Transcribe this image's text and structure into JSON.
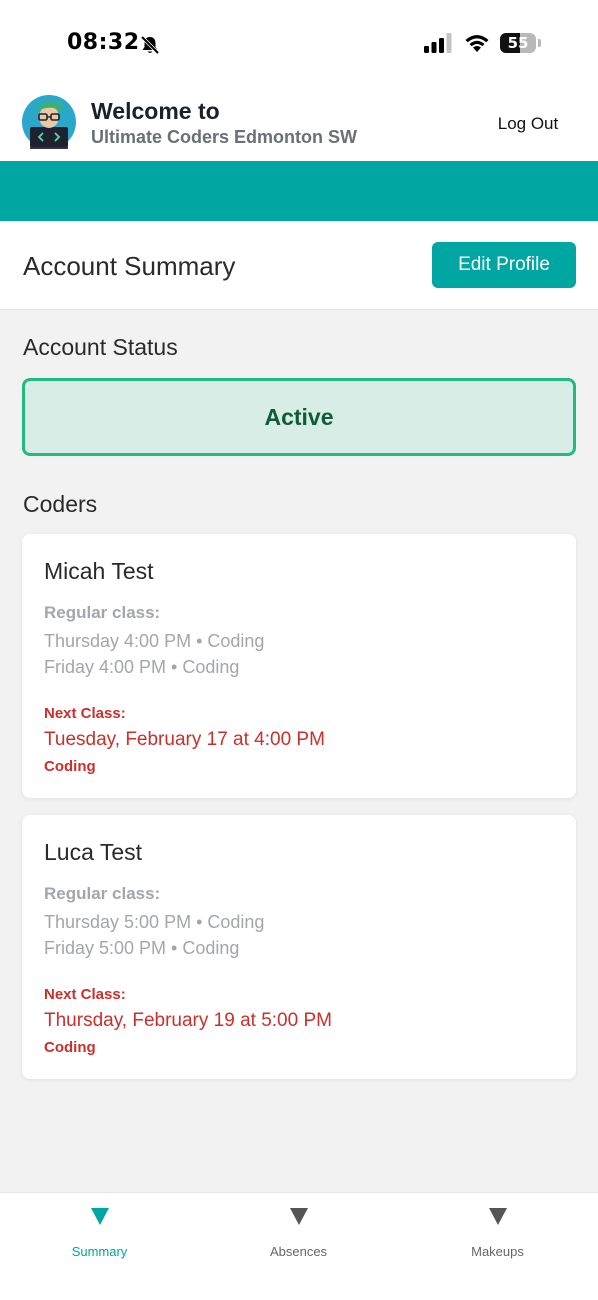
{
  "status_bar": {
    "time": "08:32",
    "battery": "55",
    "battery_level": 0.55,
    "icons": [
      "bell-slash-icon",
      "cellular-signal-icon",
      "wifi-icon",
      "battery-icon"
    ]
  },
  "header": {
    "welcome": "Welcome to",
    "school": "Ultimate Coders Edmonton SW",
    "logout": "Log Out",
    "avatar_icon": "coder-avatar-icon"
  },
  "colors": {
    "accent": "#00a6a1",
    "active_bg": "#d8ede5",
    "active_border": "#22bb7f",
    "next_class": "#c9302c"
  },
  "summary": {
    "title": "Account Summary",
    "edit_profile": "Edit Profile"
  },
  "account_status": {
    "heading": "Account Status",
    "value": "Active"
  },
  "coders": {
    "heading": "Coders",
    "items": [
      {
        "name": "Micah Test",
        "regular_label": "Regular class:",
        "schedule": [
          "Thursday 4:00 PM • Coding",
          "Friday 4:00 PM • Coding"
        ],
        "next_label": "Next Class:",
        "next_date": "Tuesday, February 17 at 4:00 PM",
        "next_subject": "Coding"
      },
      {
        "name": "Luca Test",
        "regular_label": "Regular class:",
        "schedule": [
          "Thursday 5:00 PM • Coding",
          "Friday 5:00 PM • Coding"
        ],
        "next_label": "Next Class:",
        "next_date": "Thursday, February 19 at 5:00 PM",
        "next_subject": "Coding"
      }
    ]
  },
  "tabs": [
    {
      "label": "Summary",
      "icon": "triangle-down-icon",
      "active": true
    },
    {
      "label": "Absences",
      "icon": "triangle-down-icon",
      "active": false
    },
    {
      "label": "Makeups",
      "icon": "triangle-down-icon",
      "active": false
    }
  ]
}
